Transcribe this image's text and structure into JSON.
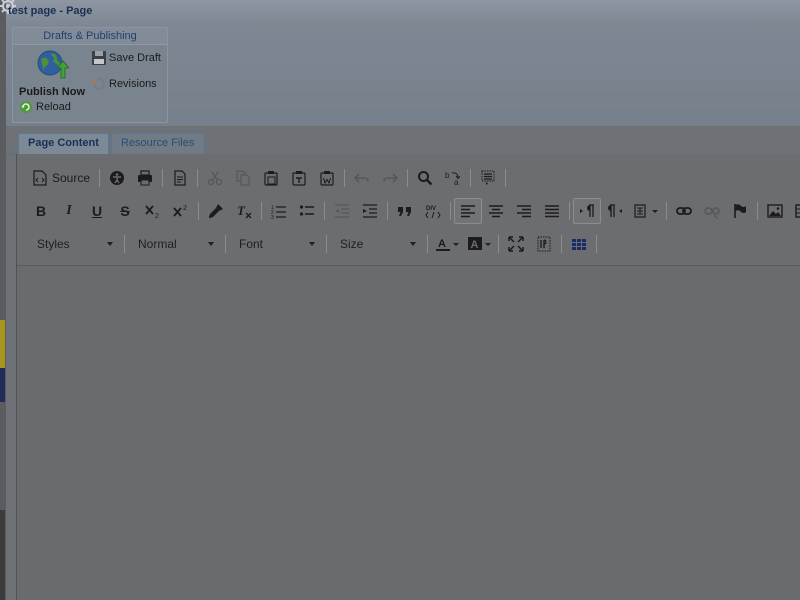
{
  "window": {
    "title": "test page - Page"
  },
  "ribbon": {
    "group_title": "Drafts & Publishing",
    "publish_now": "Publish Now",
    "save_draft": "Save Draft",
    "revisions": "Revisions",
    "reload": "Reload"
  },
  "tabs": [
    {
      "label": "Page Content",
      "active": true
    },
    {
      "label": "Resource Files",
      "active": false
    }
  ],
  "editor": {
    "source_label": "Source",
    "combos": {
      "styles": "Styles",
      "format": "Normal",
      "font": "Font",
      "size": "Size"
    },
    "content": ""
  }
}
